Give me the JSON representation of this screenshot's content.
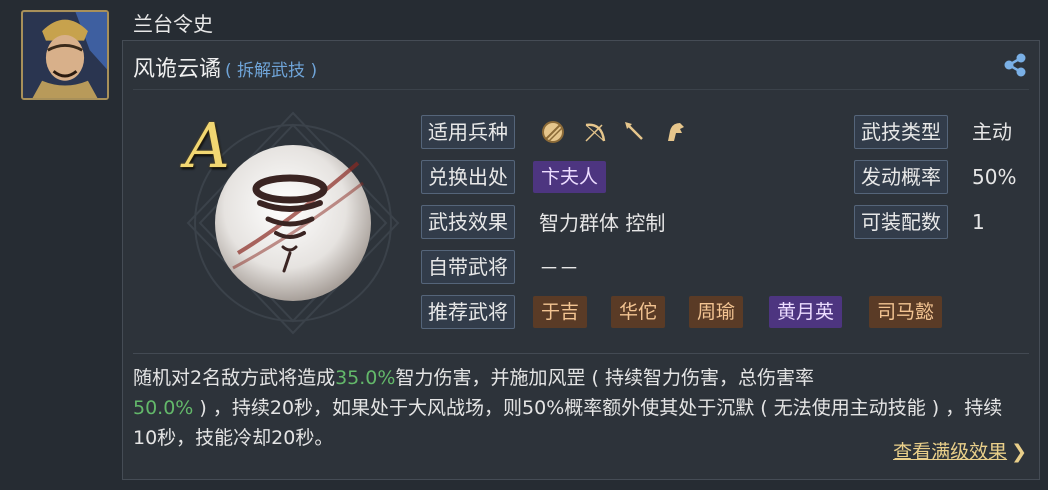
{
  "owner": {
    "name": "兰台令史"
  },
  "skill": {
    "name": "风诡云谲",
    "subtitle": "( 拆解武技 )",
    "grade": "A"
  },
  "props_left": [
    {
      "label": "适用兵种",
      "value": ""
    },
    {
      "label": "兑换出处",
      "value": ""
    },
    {
      "label": "武技效果",
      "value": "智力群体 控制"
    },
    {
      "label": "自带武将",
      "value": "－－"
    },
    {
      "label": "推荐武将",
      "value": ""
    }
  ],
  "units": [
    "shield-icon",
    "bow-icon",
    "spear-icon",
    "horse-icon"
  ],
  "source_tag": {
    "text": "卞夫人",
    "color": "#4d3580"
  },
  "recommended": [
    {
      "name": "于吉",
      "tone": "brown"
    },
    {
      "name": "华佗",
      "tone": "brown"
    },
    {
      "name": "周瑜",
      "tone": "brown"
    },
    {
      "name": "黄月英",
      "tone": "purple"
    },
    {
      "name": "司马懿",
      "tone": "brown"
    }
  ],
  "props_right": [
    {
      "label": "武技类型",
      "value": "主动"
    },
    {
      "label": "发动概率",
      "value": "50%"
    },
    {
      "label": "可装配数",
      "value": "1"
    }
  ],
  "description": {
    "p1": "随机对2名敌方武将造成",
    "h1": "35.0%",
    "p2": "智力伤害，并施加风罡 ( 持续智力伤害，总伤害率",
    "h2": "50.0%",
    "p3": " ) ，持续20秒，如果处于大风战场，则50%概率额外使其处于沉默 ( 无法使用主动技能 ) ，持续10秒，技能冷却20秒。"
  },
  "more_link": {
    "label": "查看满级效果",
    "chevron": "❯"
  },
  "colors": {
    "highlight": "#63b86a",
    "grade": "#f2d772",
    "link": "#e9cf8a",
    "subtitle": "#6fa4d8"
  }
}
